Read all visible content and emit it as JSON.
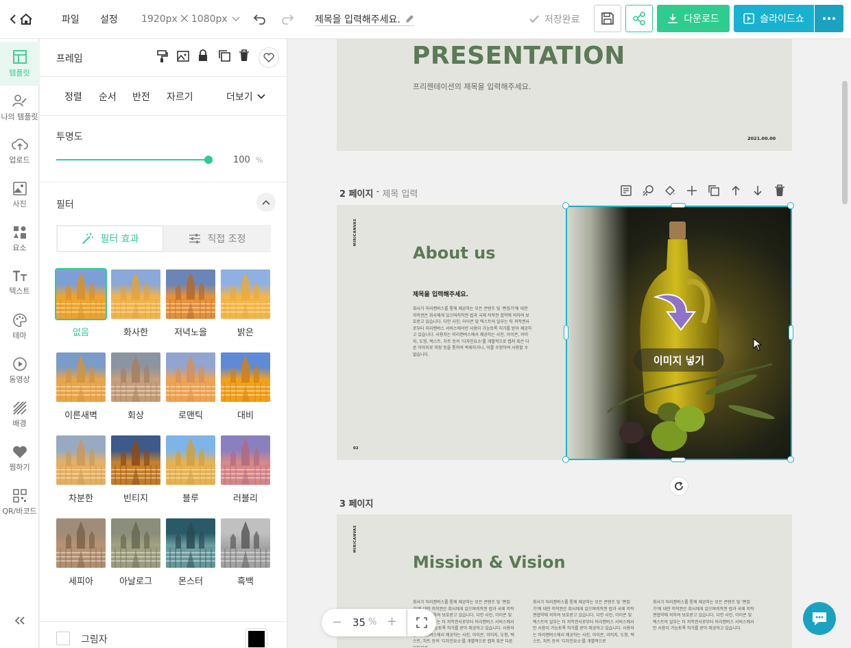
{
  "topbar": {
    "file_menu": "파일",
    "settings_menu": "설정",
    "canvas_size": "1920px ⨉ 1080px",
    "doc_title": "제목을 입력해주세요.",
    "save_status": "저장완료",
    "download_label": "다운로드",
    "slideshow_label": "슬라이드쇼"
  },
  "rail": [
    {
      "label": "템플릿",
      "icon": "template-icon"
    },
    {
      "label": "나의 템플릿",
      "icon": "my-template-icon"
    },
    {
      "label": "업로드",
      "icon": "upload-icon"
    },
    {
      "label": "사진",
      "icon": "photo-icon"
    },
    {
      "label": "요소",
      "icon": "elements-icon"
    },
    {
      "label": "텍스트",
      "icon": "text-icon"
    },
    {
      "label": "테마",
      "icon": "theme-icon"
    },
    {
      "label": "동영상",
      "icon": "video-icon"
    },
    {
      "label": "배경",
      "icon": "background-icon"
    },
    {
      "label": "찜하기",
      "icon": "heart-icon"
    },
    {
      "label": "QR/바코드",
      "icon": "qr-icon"
    }
  ],
  "panel": {
    "title": "프레임",
    "actions": [
      "정렬",
      "순서",
      "반전",
      "자르기"
    ],
    "more_label": "더보기",
    "opacity_label": "투명도",
    "opacity_value": "100",
    "opacity_unit": "%",
    "opacity_level": 1.0,
    "filter_label": "필터",
    "tab_filter_effect": "필터 효과",
    "tab_manual_adjust": "직접 조정",
    "filters": [
      "없음",
      "화사한",
      "저녁노을",
      "밝은",
      "이른새벽",
      "회상",
      "로맨틱",
      "대비",
      "차분한",
      "빈티지",
      "블루",
      "러블리",
      "세피아",
      "아날로그",
      "몬스터",
      "흑백"
    ],
    "selected_filter": "없음",
    "shadow_label": "그림자"
  },
  "canvas": {
    "slide1": {
      "title": "PRESENTATION",
      "subtitle": "프리젠테이션의 제목을 입력해주세요.",
      "date": "2021.00.00"
    },
    "page2_label": "2 페이지",
    "page2_sep": " - ",
    "page2_placeholder": "제목 입력",
    "slide2": {
      "brand": "MIRICANVAS",
      "title": "About us",
      "heading": "제목을 입력해주세요.",
      "body": "회사가 미리캔버스를 통해 제공하는 모든 콘텐츠 및 '편집기'에 대한 저작권은 회사에게 있으며저작권 법과 국제 저작권 협약에 의하여 보호받고 있습니다. 다만 사진, 아이콘 및 텍스트의 일부는 타 저작권사로부터 미리캔버스 서비스에서만 사용이 가능토록 허가를 받아 제공하고 있습니다. 사용자는 미리캔버스에서 제공하는 사진, 아이콘, 이미지, 도형, 텍스트, 차트 등의 '디자인요소'를 개별적으로 캡쳐 혹은 다른 이미지로 저장 등을 통하여 복제하거나, 이를 수정하여 사용할 수 없습니다.",
      "page_num": "02",
      "image_hint": "이미지 넣기"
    },
    "page3_label": "3 페이지",
    "slide3": {
      "brand": "MIRICANVAS",
      "title": "Mission & Vision",
      "col1": "회사가 미리캔버스를 통해 제공하는 모든 콘텐츠 및 '편집기'에 대한 저작권은 회사에게 있으며저작권 법과 국제 저작권협약에 의하여 보호받고 있습니다. 다만 사진, 아이콘 및 텍스트의 일부는 타 저작권사로부터 미리캔버스 서비스에서만 사용이 가능토록 허가를 받아 제공하고 있습니다. 사용자는 미리캔버스에서 제공하는 사진, 아이콘, 이미지, 도형, 텍스트, 차트 등의 '디자인요소'를 개별적으로 캡쳐 혹은 다른 이미지로",
      "col2": "회사가 미리캔버스를 통해 제공하는 모든 콘텐츠 및 '편집기'에 대한 저작권은 회사에게 있으며저작권 법과 국제 저작권협약에 의하여 보호받고 있습니다. 다만 사진, 아이콘 및 텍스트의 일부는 타 저작권사로부터 미리캔버스 서비스에서만 사용이 가능토록 허가를 받아 제공하고 있습니다. 사용자는 미리캔버스에서 제공하는 사진, 아이콘, 이미지, 도형, 텍스트, 차트 등의 '디자인요소'를 개별적으로",
      "col3": "회사가 미리캔버스를 통해 제공하는 모든 콘텐츠 및 '편집기'에 대한 저작권은 회사에게 있으며저작권 법과 국제 저작권협약에 의하여 보호받고 있습니다. 다만 사진, 아이콘 및 텍스트의 일부는 타 저작권사로부터 미리캔버스 서비스에서만 사용이 가능토록 허가를 받아 제공하고 있습니다."
    },
    "zoom_value": "35",
    "zoom_unit": "%"
  },
  "colors": {
    "accent": "#2ecc8f",
    "cyan": "#18b2d0",
    "slide_green": "#5b7a56",
    "slide_bg": "#e4e4de"
  }
}
